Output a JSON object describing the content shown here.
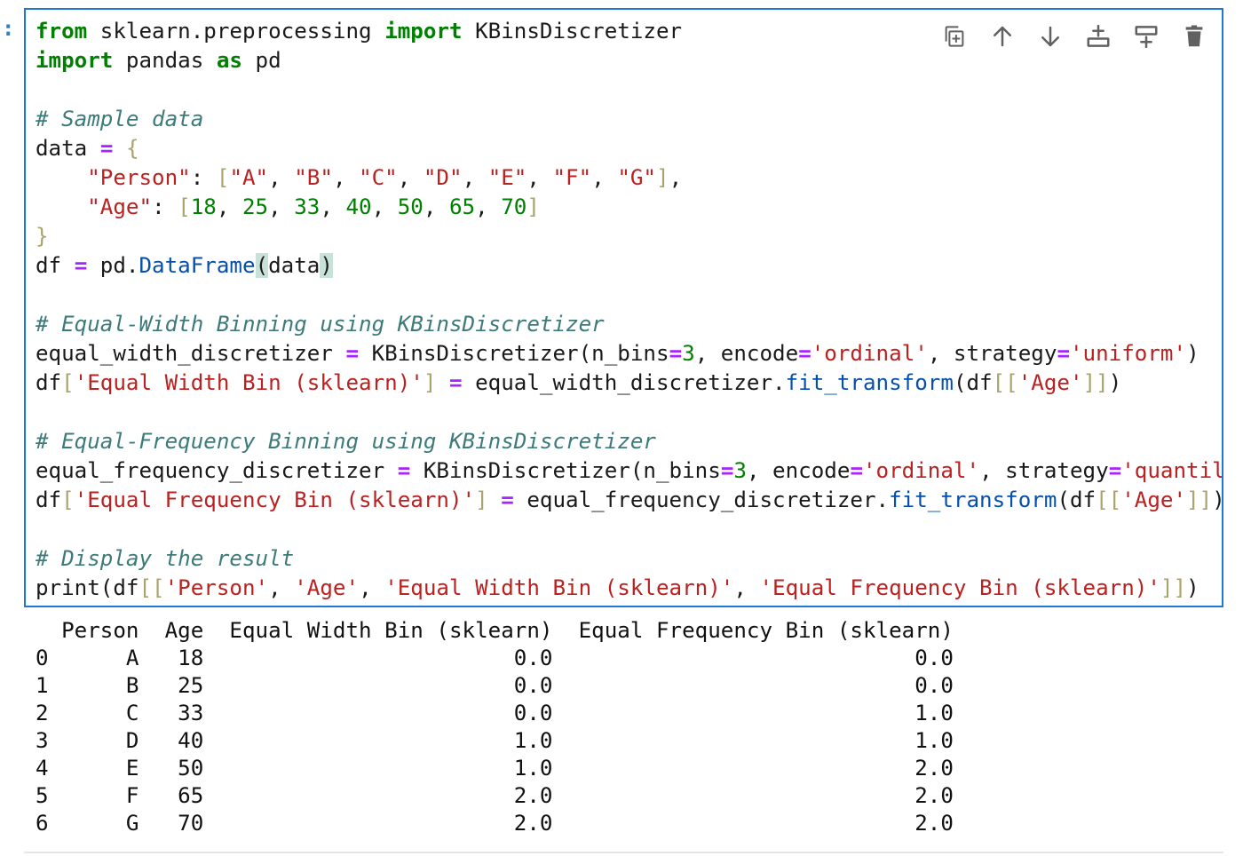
{
  "prompt": ":",
  "toolbar": [
    {
      "name": "duplicate-cell-icon",
      "title": "Duplicate cell"
    },
    {
      "name": "move-cell-up-icon",
      "title": "Move cell up"
    },
    {
      "name": "move-cell-down-icon",
      "title": "Move cell down"
    },
    {
      "name": "insert-cell-above-icon",
      "title": "Insert cell above"
    },
    {
      "name": "insert-cell-below-icon",
      "title": "Insert cell below"
    },
    {
      "name": "delete-cell-icon",
      "title": "Delete cell"
    }
  ],
  "code": {
    "lines": [
      [
        [
          "kw",
          "from"
        ],
        [
          "t",
          " sklearn.preprocessing "
        ],
        [
          "kw",
          "import"
        ],
        [
          "t",
          " KBinsDiscretizer"
        ]
      ],
      [
        [
          "kw",
          "import"
        ],
        [
          "t",
          " pandas "
        ],
        [
          "kw",
          "as"
        ],
        [
          "t",
          " pd"
        ]
      ],
      [],
      [
        [
          "cm",
          "# Sample data"
        ]
      ],
      [
        [
          "t",
          "data "
        ],
        [
          "op",
          "="
        ],
        [
          "t",
          " "
        ],
        [
          "br",
          "{"
        ]
      ],
      [
        [
          "t",
          "    "
        ],
        [
          "str",
          "\"Person\""
        ],
        [
          "t",
          ": "
        ],
        [
          "br",
          "["
        ],
        [
          "str",
          "\"A\""
        ],
        [
          "t",
          ", "
        ],
        [
          "str",
          "\"B\""
        ],
        [
          "t",
          ", "
        ],
        [
          "str",
          "\"C\""
        ],
        [
          "t",
          ", "
        ],
        [
          "str",
          "\"D\""
        ],
        [
          "t",
          ", "
        ],
        [
          "str",
          "\"E\""
        ],
        [
          "t",
          ", "
        ],
        [
          "str",
          "\"F\""
        ],
        [
          "t",
          ", "
        ],
        [
          "str",
          "\"G\""
        ],
        [
          "br",
          "]"
        ],
        [
          "t",
          ","
        ]
      ],
      [
        [
          "t",
          "    "
        ],
        [
          "str",
          "\"Age\""
        ],
        [
          "t",
          ": "
        ],
        [
          "br",
          "["
        ],
        [
          "num",
          "18"
        ],
        [
          "t",
          ", "
        ],
        [
          "num",
          "25"
        ],
        [
          "t",
          ", "
        ],
        [
          "num",
          "33"
        ],
        [
          "t",
          ", "
        ],
        [
          "num",
          "40"
        ],
        [
          "t",
          ", "
        ],
        [
          "num",
          "50"
        ],
        [
          "t",
          ", "
        ],
        [
          "num",
          "65"
        ],
        [
          "t",
          ", "
        ],
        [
          "num",
          "70"
        ],
        [
          "br",
          "]"
        ]
      ],
      [
        [
          "br",
          "}"
        ]
      ],
      [
        [
          "t",
          "df "
        ],
        [
          "op",
          "="
        ],
        [
          "t",
          " pd."
        ],
        [
          "fn",
          "DataFrame"
        ],
        [
          "hl",
          "("
        ],
        [
          "t",
          "data"
        ],
        [
          "hl",
          ")"
        ]
      ],
      [],
      [
        [
          "cm",
          "# Equal-Width Binning using KBinsDiscretizer"
        ]
      ],
      [
        [
          "t",
          "equal_width_discretizer "
        ],
        [
          "op",
          "="
        ],
        [
          "t",
          " KBinsDiscretizer(n_bins"
        ],
        [
          "op",
          "="
        ],
        [
          "num",
          "3"
        ],
        [
          "t",
          ", encode"
        ],
        [
          "op",
          "="
        ],
        [
          "str",
          "'ordinal'"
        ],
        [
          "t",
          ", strategy"
        ],
        [
          "op",
          "="
        ],
        [
          "str",
          "'uniform'"
        ],
        [
          "t",
          ")"
        ]
      ],
      [
        [
          "t",
          "df"
        ],
        [
          "br",
          "["
        ],
        [
          "str",
          "'Equal Width Bin (sklearn)'"
        ],
        [
          "br",
          "]"
        ],
        [
          "t",
          " "
        ],
        [
          "op",
          "="
        ],
        [
          "t",
          " equal_width_discretizer."
        ],
        [
          "fn",
          "fit_transform"
        ],
        [
          "t",
          "(df"
        ],
        [
          "br",
          "[["
        ],
        [
          "str",
          "'Age'"
        ],
        [
          "br",
          "]]"
        ],
        [
          "t",
          ")"
        ]
      ],
      [],
      [
        [
          "cm",
          "# Equal-Frequency Binning using KBinsDiscretizer"
        ]
      ],
      [
        [
          "t",
          "equal_frequency_discretizer "
        ],
        [
          "op",
          "="
        ],
        [
          "t",
          " KBinsDiscretizer(n_bins"
        ],
        [
          "op",
          "="
        ],
        [
          "num",
          "3"
        ],
        [
          "t",
          ", encode"
        ],
        [
          "op",
          "="
        ],
        [
          "str",
          "'ordinal'"
        ],
        [
          "t",
          ", strategy"
        ],
        [
          "op",
          "="
        ],
        [
          "str",
          "'quantile'"
        ],
        [
          "t",
          ")"
        ]
      ],
      [
        [
          "t",
          "df"
        ],
        [
          "br",
          "["
        ],
        [
          "str",
          "'Equal Frequency Bin (sklearn)'"
        ],
        [
          "br",
          "]"
        ],
        [
          "t",
          " "
        ],
        [
          "op",
          "="
        ],
        [
          "t",
          " equal_frequency_discretizer."
        ],
        [
          "fn",
          "fit_transform"
        ],
        [
          "t",
          "(df"
        ],
        [
          "br",
          "[["
        ],
        [
          "str",
          "'Age'"
        ],
        [
          "br",
          "]]"
        ],
        [
          "t",
          ")"
        ]
      ],
      [],
      [
        [
          "cm",
          "# Display the result"
        ]
      ],
      [
        [
          "t",
          "print(df"
        ],
        [
          "br",
          "[["
        ],
        [
          "str",
          "'Person'"
        ],
        [
          "t",
          ", "
        ],
        [
          "str",
          "'Age'"
        ],
        [
          "t",
          ", "
        ],
        [
          "str",
          "'Equal Width Bin (sklearn)'"
        ],
        [
          "t",
          ", "
        ],
        [
          "str",
          "'Equal Frequency Bin (sklearn)'"
        ],
        [
          "br",
          "]]"
        ],
        [
          "t",
          ")"
        ]
      ]
    ]
  },
  "output": {
    "columns": [
      "Person",
      "Age",
      "Equal Width Bin (sklearn)",
      "Equal Frequency Bin (sklearn)"
    ],
    "rows": [
      {
        "index": "0",
        "person": "A",
        "age": "18",
        "ew": "0.0",
        "ef": "0.0"
      },
      {
        "index": "1",
        "person": "B",
        "age": "25",
        "ew": "0.0",
        "ef": "0.0"
      },
      {
        "index": "2",
        "person": "C",
        "age": "33",
        "ew": "0.0",
        "ef": "1.0"
      },
      {
        "index": "3",
        "person": "D",
        "age": "40",
        "ew": "1.0",
        "ef": "1.0"
      },
      {
        "index": "4",
        "person": "E",
        "age": "50",
        "ew": "1.0",
        "ef": "2.0"
      },
      {
        "index": "5",
        "person": "F",
        "age": "65",
        "ew": "2.0",
        "ef": "2.0"
      },
      {
        "index": "6",
        "person": "G",
        "age": "70",
        "ew": "2.0",
        "ef": "2.0"
      }
    ]
  },
  "colors": {
    "cell_border": "#1f78d1",
    "keyword": "#008000",
    "string": "#ba2121",
    "comment": "#3d7b7b",
    "operator": "#aa22ff",
    "function": "#0550ae",
    "bracket": "#aaa36c",
    "icon": "#616161"
  }
}
